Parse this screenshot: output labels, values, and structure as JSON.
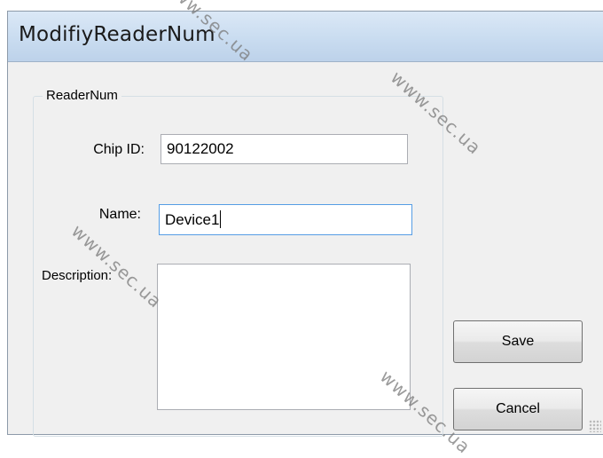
{
  "window": {
    "title": "ModifiyReaderNum"
  },
  "group": {
    "label": "ReaderNum"
  },
  "form": {
    "chip_id_label": "Chip ID:",
    "chip_id_value": "90122002",
    "name_label": "Name:",
    "name_value": "Device1",
    "description_label": "Description:",
    "description_value": ""
  },
  "buttons": {
    "save": "Save",
    "cancel": "Cancel"
  },
  "watermarks": [
    "www.sec.ua",
    "www.sec.ua",
    "www.sec.ua",
    "www.sec.ua"
  ]
}
